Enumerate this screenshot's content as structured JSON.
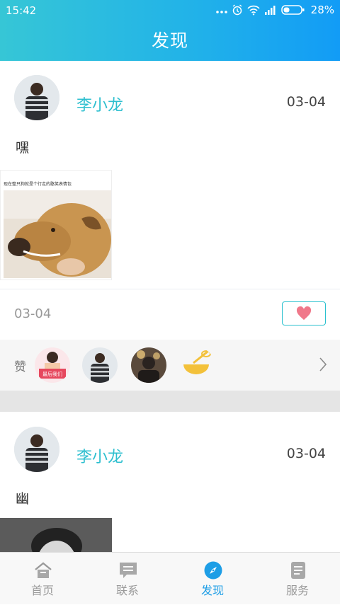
{
  "status_bar": {
    "time": "15:42",
    "battery_percent": "28%",
    "icons": [
      "more-dots-icon",
      "alarm-icon",
      "wifi-icon",
      "signal-icon",
      "battery-icon"
    ]
  },
  "header": {
    "title": "发现"
  },
  "posts": [
    {
      "user": "李小龙",
      "date": "03-04",
      "text": "嘿",
      "image_caption": "现在整只狗就是个行走的憨笑表情包",
      "footer_date": "03-04",
      "likes_label": "赞"
    },
    {
      "user": "李小龙",
      "date": "03-04",
      "text": "幽"
    }
  ],
  "liker_badge": "最后我们",
  "tabs": [
    {
      "label": "首页",
      "icon": "home-icon",
      "active": false
    },
    {
      "label": "联系",
      "icon": "chat-icon",
      "active": false
    },
    {
      "label": "发现",
      "icon": "compass-icon",
      "active": true
    },
    {
      "label": "服务",
      "icon": "document-icon",
      "active": false
    }
  ],
  "colors": {
    "accent": "#2bc1cf",
    "active_tab": "#1e9ee6",
    "header_gradient": [
      "#36c6d6",
      "#129cf6"
    ],
    "like_heart": "#f0788a"
  }
}
